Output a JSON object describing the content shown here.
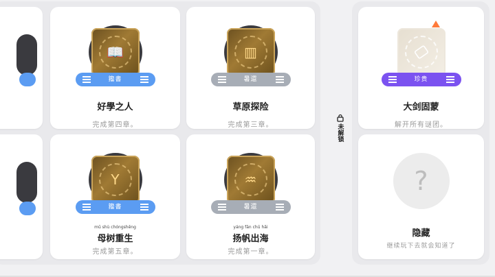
{
  "left_panel": {
    "cards": [
      {
        "title": "好學之人",
        "subtitle": "完成第四章。",
        "status": "籀書",
        "color": "#5b9cf2",
        "symbol": "📖"
      },
      {
        "title": "草原探险",
        "subtitle": "完成第三章。",
        "status": "暑還",
        "color": "#a7adb6",
        "symbol": "▥"
      },
      {
        "title": "母树重生",
        "subtitle": "完成第五章。",
        "pinyin": "mǔ shù chóngshēng",
        "status": "籀書",
        "color": "#5b9cf2",
        "symbol": "Y"
      },
      {
        "title": "扬帆出海",
        "subtitle": "完成第一章。",
        "pinyin": "yáng fān chū hǎi",
        "status": "暑還",
        "color": "#a7adb6",
        "symbol": "♒"
      }
    ]
  },
  "divider": {
    "label": "未解锁"
  },
  "right_panel": {
    "cards": [
      {
        "title": "大剑固蒙",
        "subtitle": "解开所有谜团。",
        "status": "珍贵",
        "color": "#7b52f0"
      },
      {
        "title": "隐藏",
        "subtitle": "继续玩下去就会知道了",
        "symbol": "?"
      }
    ]
  }
}
